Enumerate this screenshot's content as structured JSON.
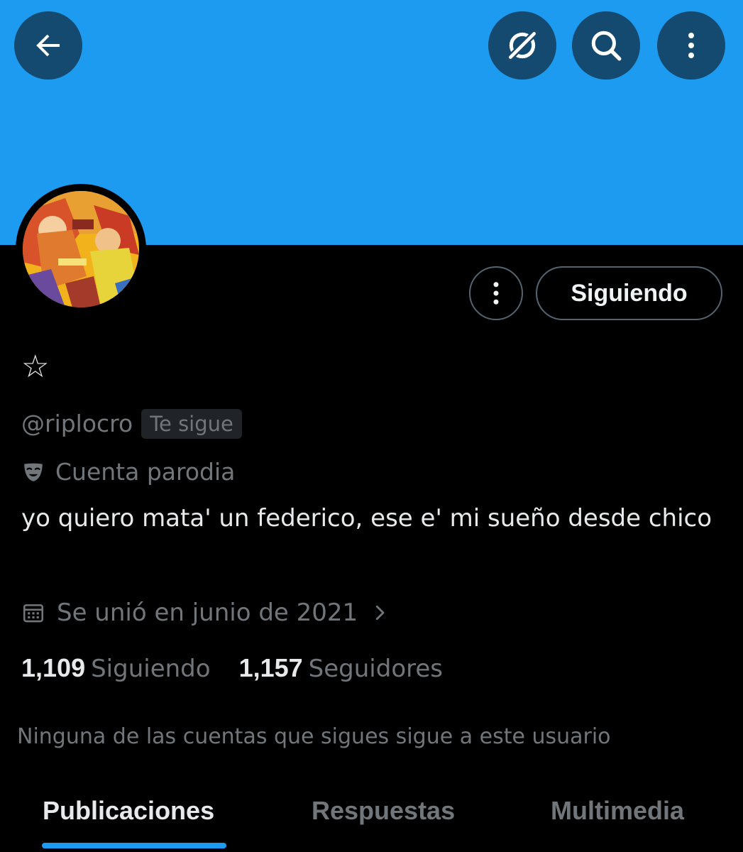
{
  "colors": {
    "banner": "#1d9bf0",
    "accent": "#1d9bf0",
    "background": "#000000",
    "muted_text": "#71767b"
  },
  "header": {
    "back_icon": "arrow-left-icon",
    "grok_icon": "grok-icon",
    "search_icon": "search-icon",
    "more_icon": "more-vertical-icon"
  },
  "profile": {
    "display_name": "☆",
    "handle": "@riplocro",
    "follows_you_badge": "Te sigue",
    "parody_icon": "theater-mask-icon",
    "parody_label": "Cuenta parodia",
    "bio": "yo quiero mata' un federico, ese e' mi sueño desde chico",
    "joined_icon": "calendar-icon",
    "joined": "Se unió en junio de 2021",
    "following_count": "1,109",
    "following_label": "Siguiendo",
    "followers_count": "1,157",
    "followers_label": "Seguidores",
    "mutuals_note": "Ninguna de las cuentas que sigues sigue a este usuario"
  },
  "actions": {
    "more_icon": "more-vertical-icon",
    "follow_button": "Siguiendo"
  },
  "tabs": [
    {
      "label": "Publicaciones",
      "active": true
    },
    {
      "label": "Respuestas",
      "active": false
    },
    {
      "label": "Multimedia",
      "active": false
    }
  ]
}
